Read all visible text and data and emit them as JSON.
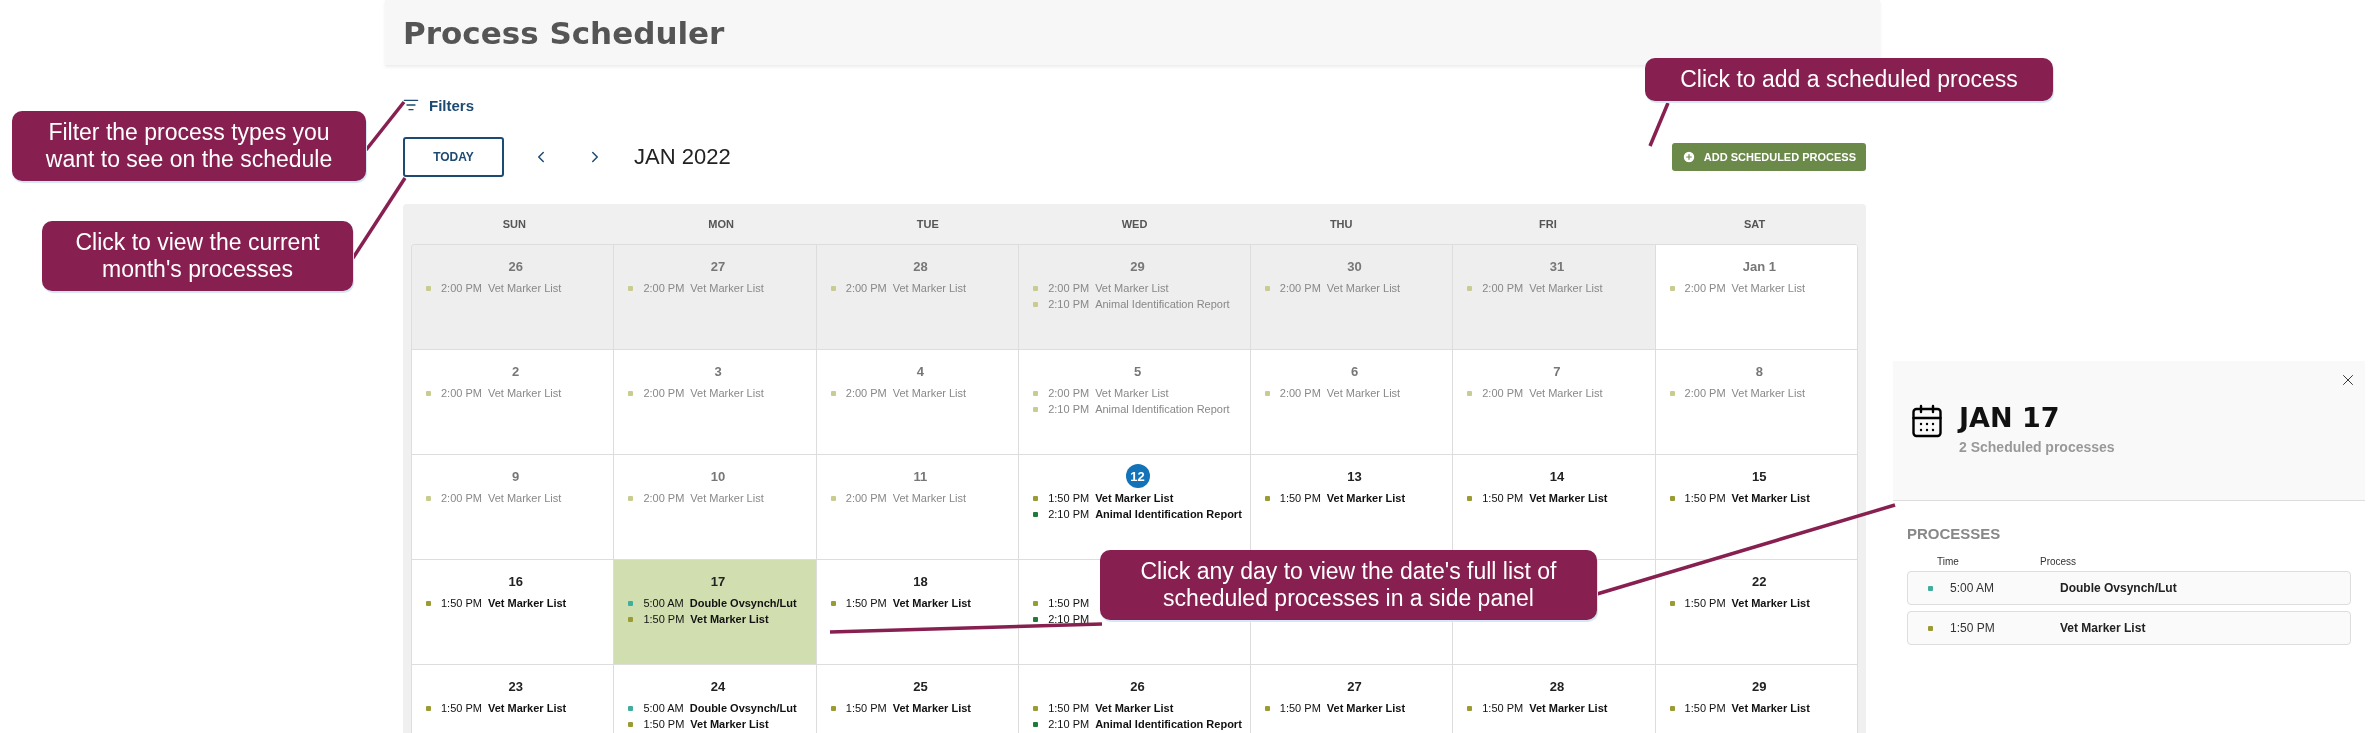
{
  "header": {
    "title": "Process Scheduler"
  },
  "toolbar": {
    "filters": "Filters",
    "today": "TODAY",
    "month": "JAN 2022",
    "add_button": "ADD SCHEDULED PROCESS"
  },
  "calendar": {
    "weekdays": [
      "SUN",
      "MON",
      "TUE",
      "WED",
      "THU",
      "FRI",
      "SAT"
    ],
    "weeks": [
      [
        {
          "day": "26",
          "outside": true,
          "past": true,
          "today": false,
          "selected": false,
          "events": [
            {
              "time": "2:00 PM",
              "name": "Vet Marker List",
              "color": "#c8cc8e"
            }
          ]
        },
        {
          "day": "27",
          "outside": true,
          "past": true,
          "today": false,
          "selected": false,
          "events": [
            {
              "time": "2:00 PM",
              "name": "Vet Marker List",
              "color": "#c8cc8e"
            }
          ]
        },
        {
          "day": "28",
          "outside": true,
          "past": true,
          "today": false,
          "selected": false,
          "events": [
            {
              "time": "2:00 PM",
              "name": "Vet Marker List",
              "color": "#c8cc8e"
            }
          ]
        },
        {
          "day": "29",
          "outside": true,
          "past": true,
          "today": false,
          "selected": false,
          "events": [
            {
              "time": "2:00 PM",
              "name": "Vet Marker List",
              "color": "#c8cc8e"
            },
            {
              "time": "2:10 PM",
              "name": "Animal Identification Report",
              "color": "#c8cc8e"
            }
          ]
        },
        {
          "day": "30",
          "outside": true,
          "past": true,
          "today": false,
          "selected": false,
          "events": [
            {
              "time": "2:00 PM",
              "name": "Vet Marker List",
              "color": "#c8cc8e"
            }
          ]
        },
        {
          "day": "31",
          "outside": true,
          "past": true,
          "today": false,
          "selected": false,
          "events": [
            {
              "time": "2:00 PM",
              "name": "Vet Marker List",
              "color": "#c8cc8e"
            }
          ]
        },
        {
          "day": "Jan 1",
          "outside": false,
          "past": true,
          "today": false,
          "selected": false,
          "events": [
            {
              "time": "2:00 PM",
              "name": "Vet Marker List",
              "color": "#c8cc8e"
            }
          ]
        }
      ],
      [
        {
          "day": "2",
          "outside": false,
          "past": true,
          "today": false,
          "selected": false,
          "events": [
            {
              "time": "2:00 PM",
              "name": "Vet Marker List",
              "color": "#c8cc8e"
            }
          ]
        },
        {
          "day": "3",
          "outside": false,
          "past": true,
          "today": false,
          "selected": false,
          "events": [
            {
              "time": "2:00 PM",
              "name": "Vet Marker List",
              "color": "#c8cc8e"
            }
          ]
        },
        {
          "day": "4",
          "outside": false,
          "past": true,
          "today": false,
          "selected": false,
          "events": [
            {
              "time": "2:00 PM",
              "name": "Vet Marker List",
              "color": "#c8cc8e"
            }
          ]
        },
        {
          "day": "5",
          "outside": false,
          "past": true,
          "today": false,
          "selected": false,
          "events": [
            {
              "time": "2:00 PM",
              "name": "Vet Marker List",
              "color": "#c8cc8e"
            },
            {
              "time": "2:10 PM",
              "name": "Animal Identification Report",
              "color": "#c8cc8e"
            }
          ]
        },
        {
          "day": "6",
          "outside": false,
          "past": true,
          "today": false,
          "selected": false,
          "events": [
            {
              "time": "2:00 PM",
              "name": "Vet Marker List",
              "color": "#c8cc8e"
            }
          ]
        },
        {
          "day": "7",
          "outside": false,
          "past": true,
          "today": false,
          "selected": false,
          "events": [
            {
              "time": "2:00 PM",
              "name": "Vet Marker List",
              "color": "#c8cc8e"
            }
          ]
        },
        {
          "day": "8",
          "outside": false,
          "past": true,
          "today": false,
          "selected": false,
          "events": [
            {
              "time": "2:00 PM",
              "name": "Vet Marker List",
              "color": "#c8cc8e"
            }
          ]
        }
      ],
      [
        {
          "day": "9",
          "outside": false,
          "past": true,
          "today": false,
          "selected": false,
          "events": [
            {
              "time": "2:00 PM",
              "name": "Vet Marker List",
              "color": "#c8cc8e"
            }
          ]
        },
        {
          "day": "10",
          "outside": false,
          "past": true,
          "today": false,
          "selected": false,
          "events": [
            {
              "time": "2:00 PM",
              "name": "Vet Marker List",
              "color": "#c8cc8e"
            }
          ]
        },
        {
          "day": "11",
          "outside": false,
          "past": true,
          "today": false,
          "selected": false,
          "events": [
            {
              "time": "2:00 PM",
              "name": "Vet Marker List",
              "color": "#c8cc8e"
            }
          ]
        },
        {
          "day": "12",
          "outside": false,
          "past": false,
          "today": true,
          "selected": false,
          "events": [
            {
              "time": "1:50 PM",
              "name": "Vet Marker List",
              "color": "#9b9b34"
            },
            {
              "time": "2:10 PM",
              "name": "Animal Identification Report",
              "color": "#1f7a3c"
            }
          ]
        },
        {
          "day": "13",
          "outside": false,
          "past": false,
          "today": false,
          "selected": false,
          "events": [
            {
              "time": "1:50 PM",
              "name": "Vet Marker List",
              "color": "#9b9b34"
            }
          ]
        },
        {
          "day": "14",
          "outside": false,
          "past": false,
          "today": false,
          "selected": false,
          "events": [
            {
              "time": "1:50 PM",
              "name": "Vet Marker List",
              "color": "#9b9b34"
            }
          ]
        },
        {
          "day": "15",
          "outside": false,
          "past": false,
          "today": false,
          "selected": false,
          "events": [
            {
              "time": "1:50 PM",
              "name": "Vet Marker List",
              "color": "#9b9b34"
            }
          ]
        }
      ],
      [
        {
          "day": "16",
          "outside": false,
          "past": false,
          "today": false,
          "selected": false,
          "events": [
            {
              "time": "1:50 PM",
              "name": "Vet Marker List",
              "color": "#9b9b34"
            }
          ]
        },
        {
          "day": "17",
          "outside": false,
          "past": false,
          "today": false,
          "selected": true,
          "events": [
            {
              "time": "5:00 AM",
              "name": "Double Ovsynch/Lut",
              "color": "#3fae9c"
            },
            {
              "time": "1:50 PM",
              "name": "Vet Marker List",
              "color": "#9b9b34"
            }
          ]
        },
        {
          "day": "18",
          "outside": false,
          "past": false,
          "today": false,
          "selected": false,
          "events": [
            {
              "time": "1:50 PM",
              "name": "Vet Marker List",
              "color": "#9b9b34"
            }
          ]
        },
        {
          "outside": false,
          "past": false,
          "selected": false,
          "events": [
            {
              "time": "1:50 PM",
              "color": "#9b9b34"
            },
            {
              "time": "2:10 PM",
              "color": "#1f7a3c"
            }
          ]
        },
        {
          "outside": false,
          "selected": false
        },
        {
          "outside": false,
          "selected": false
        },
        {
          "day": "22",
          "outside": false,
          "past": false,
          "today": false,
          "selected": false,
          "events": [
            {
              "time": "1:50 PM",
              "name": "Vet Marker List",
              "color": "#9b9b34"
            }
          ]
        }
      ],
      [
        {
          "day": "23",
          "outside": false,
          "past": false,
          "today": false,
          "selected": false,
          "events": [
            {
              "time": "1:50 PM",
              "name": "Vet Marker List",
              "color": "#9b9b34"
            }
          ]
        },
        {
          "day": "24",
          "outside": false,
          "past": false,
          "today": false,
          "selected": false,
          "events": [
            {
              "time": "5:00 AM",
              "name": "Double Ovsynch/Lut",
              "color": "#3fae9c"
            },
            {
              "time": "1:50 PM",
              "name": "Vet Marker List",
              "color": "#9b9b34"
            }
          ]
        },
        {
          "day": "25",
          "outside": false,
          "past": false,
          "today": false,
          "selected": false,
          "events": [
            {
              "time": "1:50 PM",
              "name": "Vet Marker List",
              "color": "#9b9b34"
            }
          ]
        },
        {
          "day": "26",
          "outside": false,
          "past": false,
          "today": false,
          "selected": false,
          "events": [
            {
              "time": "1:50 PM",
              "name": "Vet Marker List",
              "color": "#9b9b34"
            },
            {
              "time": "2:10 PM",
              "name": "Animal Identification Report",
              "color": "#1f7a3c"
            }
          ]
        },
        {
          "day": "27",
          "outside": false,
          "past": false,
          "today": false,
          "selected": false,
          "events": [
            {
              "time": "1:50 PM",
              "name": "Vet Marker List",
              "color": "#9b9b34"
            }
          ]
        },
        {
          "day": "28",
          "outside": false,
          "past": false,
          "today": false,
          "selected": false,
          "events": [
            {
              "time": "1:50 PM",
              "name": "Vet Marker List",
              "color": "#9b9b34"
            }
          ]
        },
        {
          "day": "29",
          "outside": false,
          "past": false,
          "today": false,
          "selected": false,
          "events": [
            {
              "time": "1:50 PM",
              "name": "Vet Marker List",
              "color": "#9b9b34"
            }
          ]
        }
      ]
    ]
  },
  "side_panel": {
    "date": "JAN 17",
    "subtitle": "2 Scheduled processes",
    "section": "PROCESSES",
    "columns": [
      "Time",
      "Process"
    ],
    "rows": [
      {
        "time": "5:00 AM",
        "process": "Double Ovsynch/Lut",
        "color": "#3fae9c"
      },
      {
        "time": "1:50 PM",
        "process": "Vet Marker List",
        "color": "#9b9b34"
      }
    ]
  },
  "callouts": [
    {
      "text": "Filter the process types you want to see on the schedule"
    },
    {
      "text": "Click to view the current month's processes"
    },
    {
      "text": "Click to add a scheduled process"
    },
    {
      "text": "Click any day to view the date's full list of scheduled processes in a side panel"
    }
  ]
}
